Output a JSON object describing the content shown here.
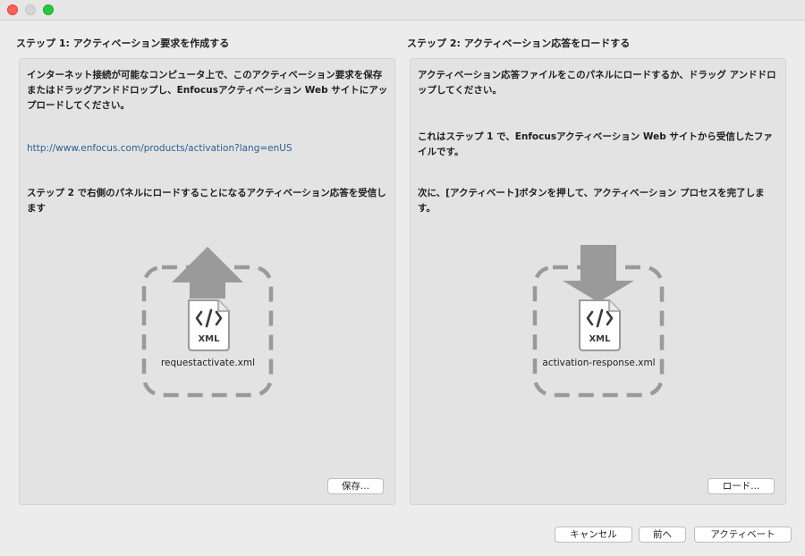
{
  "step1": {
    "title": "ステップ 1: アクティベーション要求を作成する",
    "paragraph1": "インターネット接続が可能なコンピュータ上で、このアクティベーション要求を保存またはドラッグアンドドロップし、Enfocusアクティベーション Web サイトにアップロードしてください。",
    "link": "http://www.enfocus.com/products/activation?lang=enUS",
    "paragraph2": "ステップ 2 で右側のパネルにロードすることになるアクティベーション応答を受信します",
    "file_label": "XML",
    "filename": "requestactivate.xml",
    "save_button": "保存..."
  },
  "step2": {
    "title": "ステップ 2: アクティベーション応答をロードする",
    "paragraph1": "アクティベーション応答ファイルをこのパネルにロードするか、ドラッグ アンドドロップしてください。",
    "paragraph2": "これはステップ 1 で、Enfocusアクティベーション Web サイトから受信したファイルです。",
    "paragraph3": "次に、[アクティベート]ボタンを押して、アクティベーション プロセスを完了します。",
    "file_label": "XML",
    "filename": "activation-response.xml",
    "load_button": "ロード..."
  },
  "footer": {
    "cancel_button": "キャンセル",
    "back_button": "前へ",
    "activate_button": "アクティベート"
  },
  "icons": {
    "upload": "upload-arrow-icon",
    "download": "download-arrow-icon",
    "file": "xml-file-icon"
  },
  "colors": {
    "link": "#2c5f93",
    "icon_gray": "#9a9a9a",
    "close": "#fe5f57",
    "zoom": "#27c840"
  }
}
